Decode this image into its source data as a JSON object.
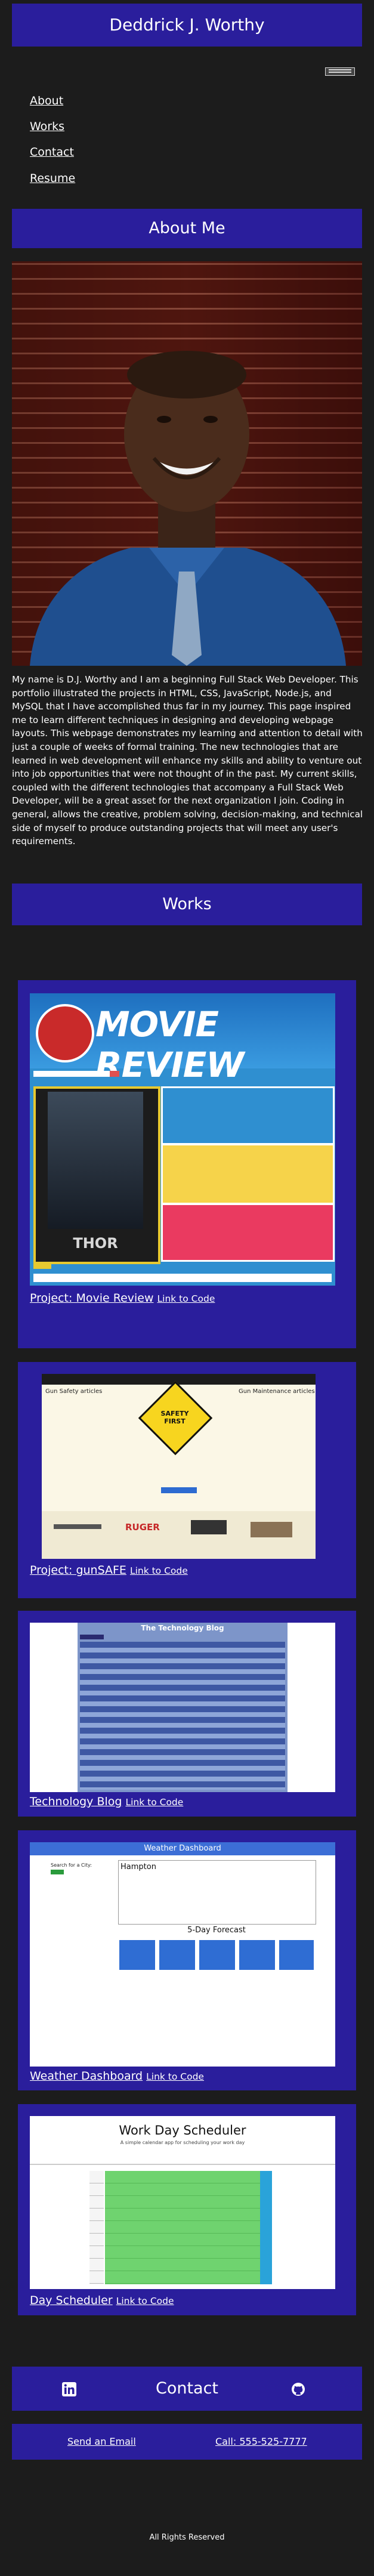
{
  "header": {
    "title": "Deddrick J. Worthy"
  },
  "nav": {
    "items": [
      "About",
      "Works",
      "Contact",
      "Resume"
    ]
  },
  "about": {
    "heading": "About Me",
    "bio": "My name is D.J. Worthy and I am a beginning Full Stack Web Developer. This portfolio illustrated the projects in HTML, CSS, JavaScript, Node.js, and MySQL that I have accomplished thus far in my journey. This page inspired me to learn different techniques in designing and developing webpage layouts. This webpage demonstrates my learning and attention to detail with just a couple of weeks of formal training. The new technologies that are learned in web development will enhance my skills and ability to venture out into job opportunities that were not thought of in the past. My current skills, coupled with the different technologies that accompany a Full Stack Web Developer, will be a great asset for the next organization I join. Coding in general, allows the creative, problem solving, decision-making, and technical side of myself to produce outstanding projects that will meet any user's requirements."
  },
  "works": {
    "heading": "Works",
    "projects": [
      {
        "title": "Project: Movie Review",
        "link": "Link to Code",
        "banner": "MOVIE REVIEW",
        "poster": "THOR"
      },
      {
        "title": "Project: gunSAFE",
        "link": "Link to Code",
        "left_col": "Gun Safety articles",
        "right_col": "Gun Maintenance articles",
        "sign": "SAFETY FIRST",
        "brand": "RUGER"
      },
      {
        "title": "Technology Blog",
        "link": "Link to Code",
        "blog_title": "The Technology Blog"
      },
      {
        "title": "Weather Dashboard",
        "link": "Link to Code",
        "dash_title": "Weather Dashboard",
        "search_label": "Search for a City:",
        "city": "Hampton",
        "forecast": "5-Day Forecast"
      },
      {
        "title": "Day Scheduler",
        "link": "Link to Code",
        "sched_title": "Work Day Scheduler",
        "sched_sub": "A simple calendar app for scheduling your work day"
      }
    ]
  },
  "contact": {
    "heading": "Contact",
    "email_label": "Send an Email",
    "phone_label": "Call: 555-525-7777"
  },
  "footer": {
    "rights": "All Rights Reserved"
  },
  "colors": {
    "page_bg": "#1c1c1c",
    "brand": "#2a1e9c"
  },
  "icons": [
    "menu-icon",
    "linkedin-icon",
    "github-icon"
  ]
}
